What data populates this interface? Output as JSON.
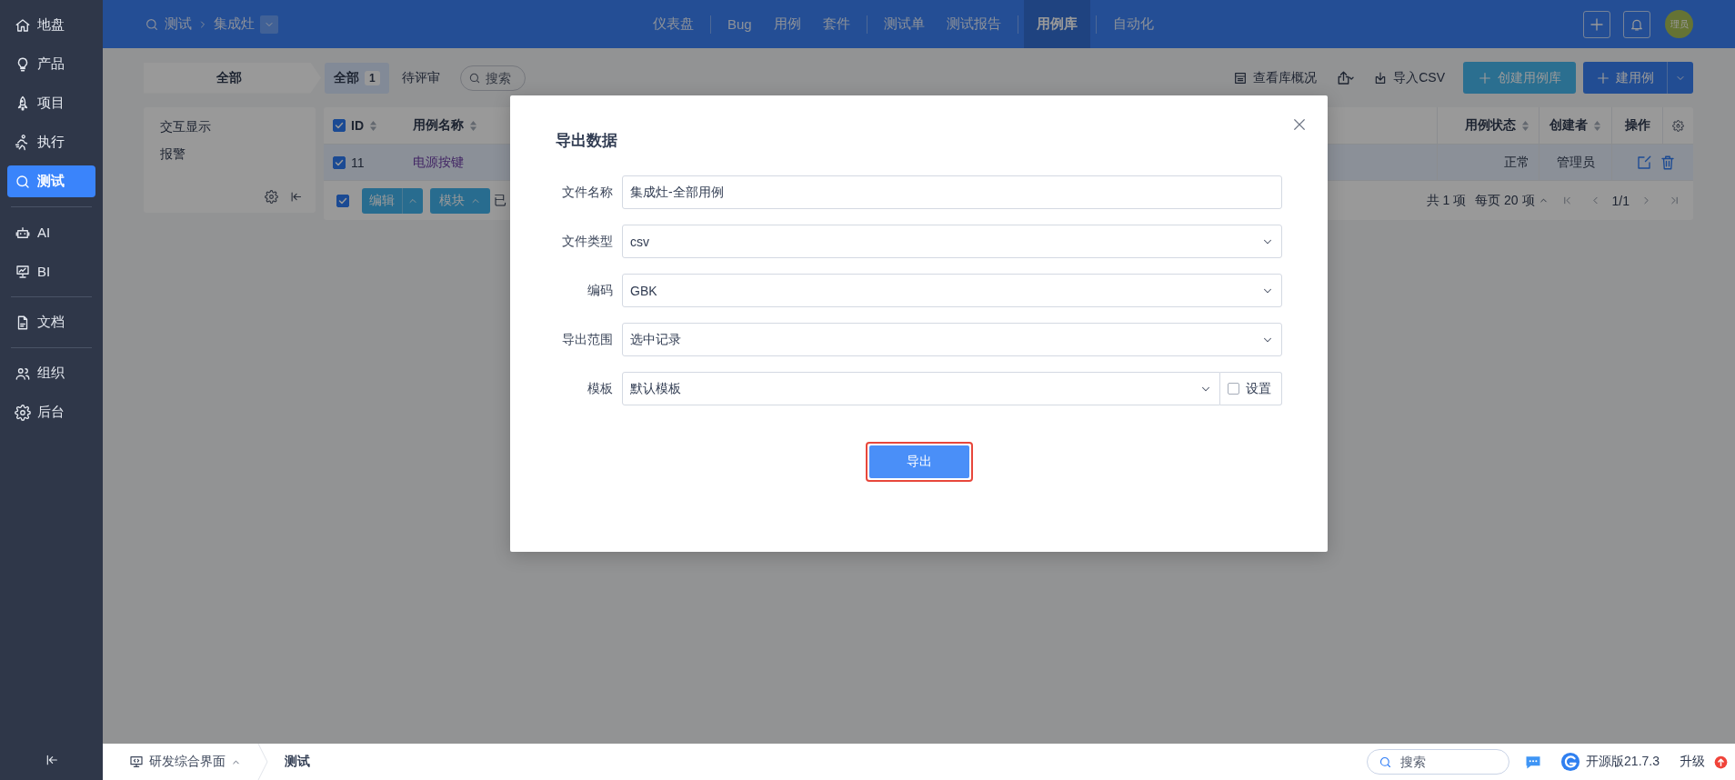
{
  "sidebar": {
    "groups": [
      [
        {
          "label": "地盘",
          "selected": false
        },
        {
          "label": "产品",
          "selected": false
        },
        {
          "label": "项目",
          "selected": false
        },
        {
          "label": "执行",
          "selected": false
        },
        {
          "label": "测试",
          "selected": true
        }
      ],
      [
        {
          "label": "AI",
          "selected": false
        },
        {
          "label": "BI",
          "selected": false
        }
      ],
      [
        {
          "label": "文档",
          "selected": false
        }
      ],
      [
        {
          "label": "组织",
          "selected": false
        },
        {
          "label": "后台",
          "selected": false
        }
      ]
    ]
  },
  "header": {
    "breadcrumb": {
      "module": "测试",
      "product": "集成灶"
    },
    "nav_groups": [
      [
        {
          "label": "仪表盘",
          "selected": false
        }
      ],
      [
        {
          "label": "Bug",
          "selected": false
        },
        {
          "label": "用例",
          "selected": false
        },
        {
          "label": "套件",
          "selected": false
        }
      ],
      [
        {
          "label": "测试单",
          "selected": false
        },
        {
          "label": "测试报告",
          "selected": false
        }
      ],
      [
        {
          "label": "用例库",
          "selected": true
        }
      ],
      [
        {
          "label": "自动化",
          "selected": false
        }
      ]
    ],
    "avatar": "理员"
  },
  "toolbar": {
    "module_tab": "全部",
    "filters": [
      {
        "label": "全部",
        "count": "1",
        "selected": true
      },
      {
        "label": "待评审",
        "selected": false
      }
    ],
    "search": {
      "placeholder": "搜索"
    },
    "overview": "查看库概况",
    "import": "导入CSV",
    "create_lib": "创建用例库",
    "create_case": "建用例"
  },
  "tree": {
    "items": [
      "交互显示",
      "报警"
    ]
  },
  "table": {
    "columns": [
      "ID",
      "用例名称",
      "用例状态",
      "创建者",
      "操作"
    ],
    "all_checked": true,
    "rows": [
      {
        "checked": true,
        "id": "11",
        "name": "电源按键",
        "status": "正常",
        "creator": "管理员"
      }
    ],
    "batch": {
      "checked": true,
      "buttons": [
        "编辑",
        "模块"
      ],
      "note": "已"
    },
    "pager": {
      "total": "共 1 项",
      "per_page": "每页 20 项",
      "page": "1/1"
    }
  },
  "dialog": {
    "title": "导出数据",
    "fields": [
      {
        "label": "文件名称",
        "kind": "text",
        "value": "集成灶-全部用例"
      },
      {
        "label": "文件类型",
        "kind": "select",
        "value": "csv"
      },
      {
        "label": "编码",
        "kind": "select",
        "value": "GBK"
      },
      {
        "label": "导出范围",
        "kind": "select",
        "value": "选中记录"
      },
      {
        "label": "模板",
        "kind": "select_setting",
        "value": "默认模板",
        "setting": {
          "label": "设置",
          "checked": false
        }
      }
    ],
    "submit": {
      "label": "导出",
      "highlighted": true
    }
  },
  "footer": {
    "app": "研发综合界面",
    "crumb": "测试",
    "search": {
      "placeholder": "搜索"
    },
    "edition": "开源版21.7.3",
    "upgrade": "升级"
  }
}
